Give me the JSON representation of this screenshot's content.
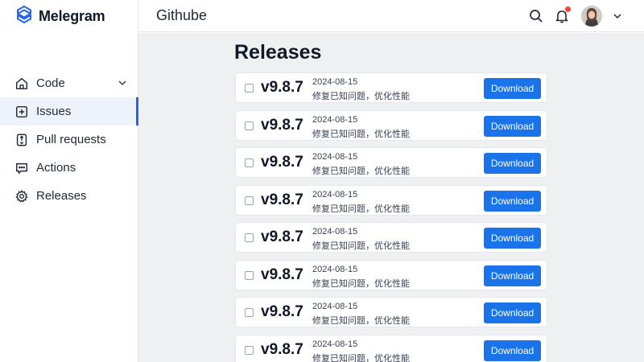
{
  "brand": {
    "name": "Melegram",
    "accent": "#2563eb"
  },
  "sidebar": {
    "items": [
      {
        "label": "Code",
        "icon": "home-icon",
        "has_chevron": true
      },
      {
        "label": "Issues",
        "icon": "plus-square-icon",
        "active": true
      },
      {
        "label": "Pull requests",
        "icon": "pull-request-icon"
      },
      {
        "label": "Actions",
        "icon": "chat-icon"
      },
      {
        "label": "Releases",
        "icon": "gear-icon"
      }
    ]
  },
  "header": {
    "title": "Githube",
    "icons": [
      "search-icon",
      "bell-icon",
      "avatar",
      "chevron-down-icon"
    ],
    "notification_badge_color": "#ef4444"
  },
  "main": {
    "page_title": "Releases",
    "download_color": "#1a73e8",
    "releases": [
      {
        "version": "v9.8.7",
        "date": "2024-08-15",
        "description": "修复已知问题，优化性能",
        "download_label": "Download"
      },
      {
        "version": "v9.8.7",
        "date": "2024-08-15",
        "description": "修复已知问题，优化性能",
        "download_label": "Download"
      },
      {
        "version": "v9.8.7",
        "date": "2024-08-15",
        "description": "修复已知问题，优化性能",
        "download_label": "Download"
      },
      {
        "version": "v9.8.7",
        "date": "2024-08-15",
        "description": "修复已知问题，优化性能",
        "download_label": "Download"
      },
      {
        "version": "v9.8.7",
        "date": "2024-08-15",
        "description": "修复已知问题，优化性能",
        "download_label": "Download"
      },
      {
        "version": "v9.8.7",
        "date": "2024-08-15",
        "description": "修复已知问题，优化性能",
        "download_label": "Download"
      },
      {
        "version": "v9.8.7",
        "date": "2024-08-15",
        "description": "修复已知问题，优化性能",
        "download_label": "Download"
      },
      {
        "version": "v9.8.7",
        "date": "2024-08-15",
        "description": "修复已知问题，优化性能",
        "download_label": "Download"
      }
    ]
  }
}
